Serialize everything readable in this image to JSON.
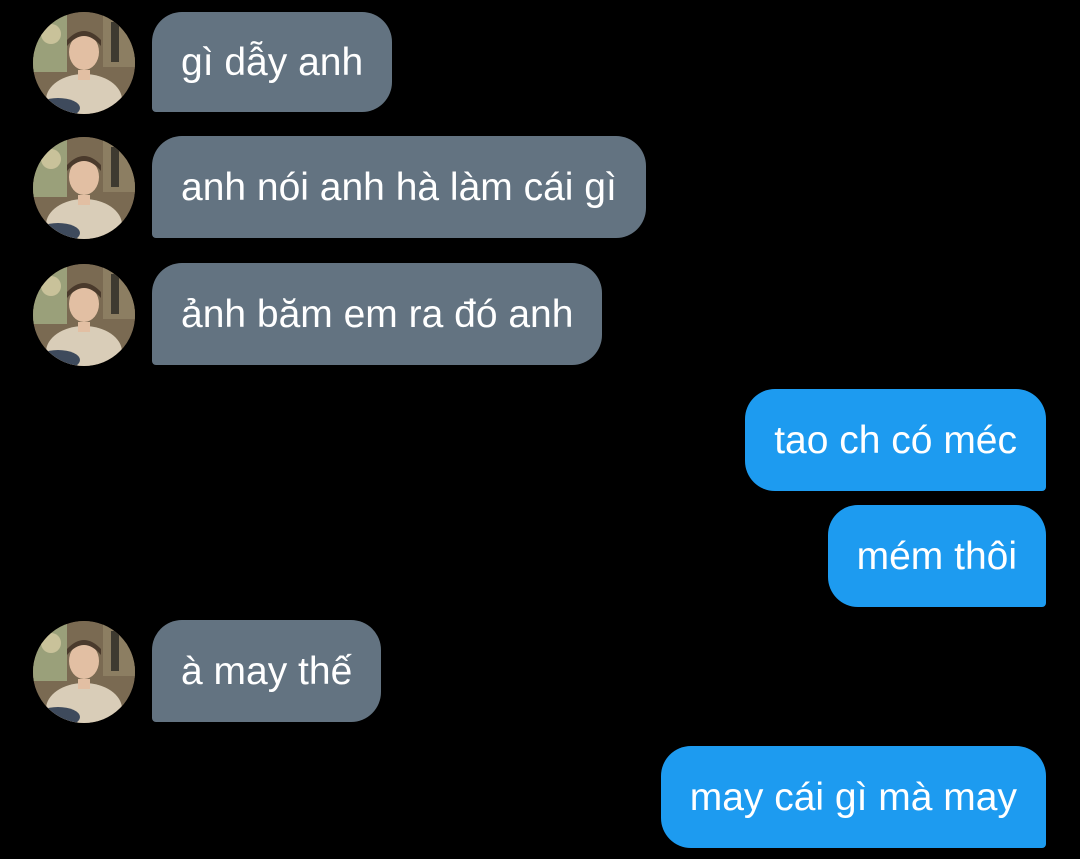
{
  "colors": {
    "background": "#000000",
    "incoming_bubble": "#637381",
    "outgoing_bubble": "#1d9bf0",
    "text": "#ffffff"
  },
  "messages": [
    {
      "direction": "incoming",
      "text": "gì dẫy anh",
      "avatar": "contact-avatar"
    },
    {
      "direction": "incoming",
      "text": "anh nói anh hà làm cái gì",
      "avatar": "contact-avatar"
    },
    {
      "direction": "incoming",
      "text": "ảnh băm em ra đó anh",
      "avatar": "contact-avatar"
    },
    {
      "direction": "outgoing",
      "text": "tao ch có méc"
    },
    {
      "direction": "outgoing",
      "text": "mém thôi"
    },
    {
      "direction": "incoming",
      "text": "à may thế",
      "avatar": "contact-avatar"
    },
    {
      "direction": "outgoing",
      "text": "may cái gì mà may"
    }
  ]
}
